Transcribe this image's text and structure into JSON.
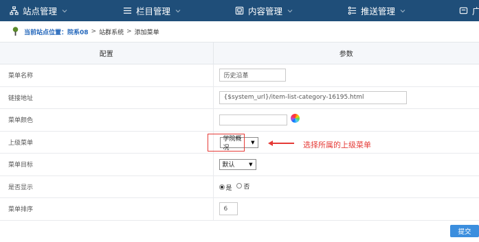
{
  "nav": {
    "site": "站点管理",
    "column": "栏目管理",
    "content": "内容管理",
    "push": "推送管理",
    "partial": "广"
  },
  "breadcrumb": {
    "prefix": "当前站点位置：院系08",
    "sep": ">",
    "system": "站群系统",
    "page": "添加菜单"
  },
  "table": {
    "header_config": "配置",
    "header_param": "参数",
    "rows": {
      "name_label": "菜单名称",
      "name_value": "历史沿革",
      "link_label": "链接地址",
      "link_value": "{$system_url}/item-list-category-16195.html",
      "color_label": "菜单颜色",
      "color_value": "",
      "parent_label": "上级菜单",
      "parent_value": "学院概况",
      "target_label": "菜单目标",
      "target_value": "默认",
      "show_label": "是否显示",
      "show_yes": "是",
      "show_no": "否",
      "show_selected": "是",
      "order_label": "菜单排序",
      "order_value": "6"
    }
  },
  "annotation": {
    "text": "选择所属的上级菜单",
    "color": "#e53935"
  },
  "submit_label": "提交",
  "colors": {
    "nav_bg": "#1f4e79",
    "accent": "#3b8ede"
  }
}
